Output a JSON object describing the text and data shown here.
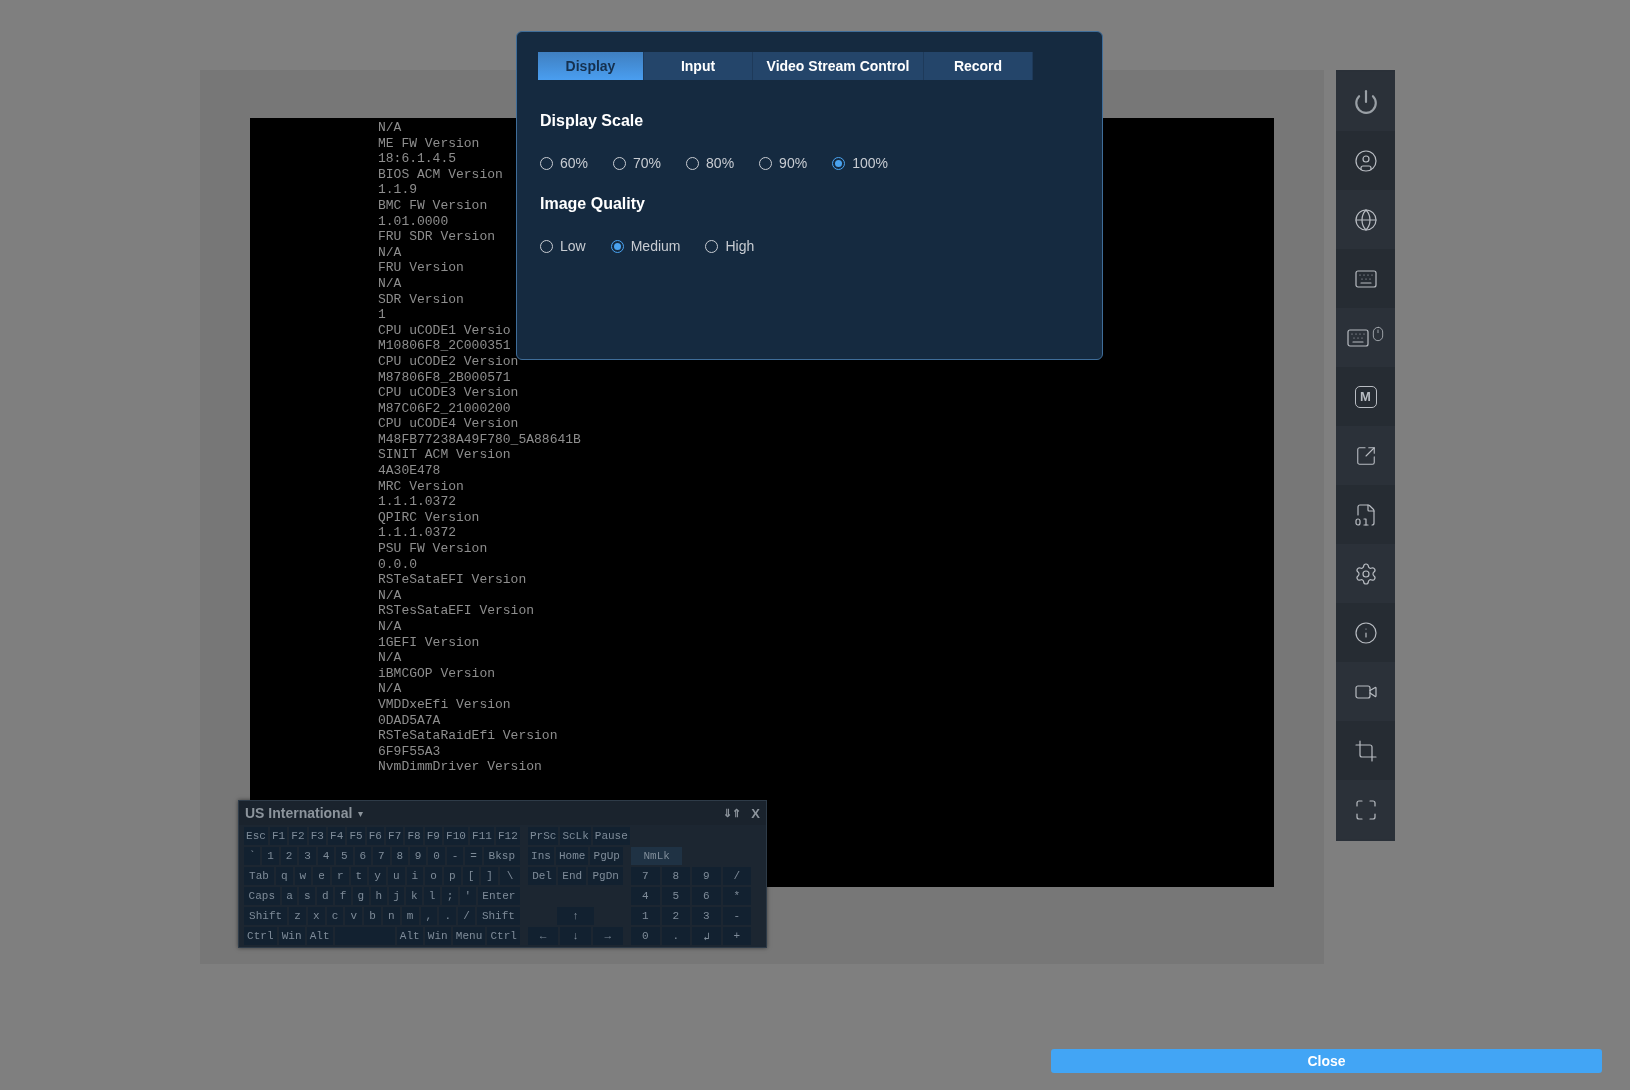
{
  "console": {
    "lines": [
      "N/A",
      "ME FW Version",
      "18:6.1.4.5",
      "BIOS ACM Version",
      "1.1.9",
      "BMC FW Version",
      "1.01.0000",
      "FRU SDR Version",
      "N/A",
      "FRU Version",
      "N/A",
      "SDR Version",
      "1",
      "CPU uCODE1 Versio",
      "M10806F8_2C000351",
      "CPU uCODE2 Version",
      "M87806F8_2B000571",
      "CPU uCODE3 Version",
      "M87C06F2_21000200",
      "CPU uCODE4 Version",
      "M48FB77238A49F780_5A88641B",
      "SINIT ACM Version",
      "4A30E478",
      "MRC Version",
      "1.1.1.0372",
      "QPIRC Version",
      "1.1.1.0372",
      "PSU FW Version",
      "0.0.0",
      "RSTeSataEFI Version",
      "N/A",
      "RSTesSataEFI Version",
      "N/A",
      "1GEFI Version",
      "N/A",
      "iBMCGOP Version",
      "N/A",
      "VMDDxeEfi Version",
      "0DAD5A7A",
      "RSTeSataRaidEfi Version",
      "6F9F55A3",
      "NvmDimmDriver Version"
    ]
  },
  "sidebar": {
    "macro_label": "M"
  },
  "dialog": {
    "tabs": [
      {
        "label": "Display",
        "selected": true
      },
      {
        "label": "Input",
        "selected": false
      },
      {
        "label": "Video Stream Control",
        "selected": false
      },
      {
        "label": "Record",
        "selected": false
      }
    ],
    "sections": [
      {
        "title": "Display Scale",
        "options": [
          {
            "label": "60%",
            "selected": false
          },
          {
            "label": "70%",
            "selected": false
          },
          {
            "label": "80%",
            "selected": false
          },
          {
            "label": "90%",
            "selected": false
          },
          {
            "label": "100%",
            "selected": true
          }
        ]
      },
      {
        "title": "Image Quality",
        "options": [
          {
            "label": "Low",
            "selected": false
          },
          {
            "label": "Medium",
            "selected": true
          },
          {
            "label": "High",
            "selected": false
          }
        ]
      }
    ]
  },
  "keyboard": {
    "layout": "US International",
    "layout_caret": "▾",
    "dock_arrows": "⇓⇑",
    "close": "X",
    "main": [
      [
        {
          "label": "Esc",
          "kind": "wide"
        },
        {
          "label": "F1",
          "kind": "key"
        },
        {
          "label": "F2",
          "kind": "key"
        },
        {
          "label": "F3",
          "kind": "key"
        },
        {
          "label": "F4",
          "kind": "key"
        },
        {
          "label": "F5",
          "kind": "key"
        },
        {
          "label": "F6",
          "kind": "key"
        },
        {
          "label": "F7",
          "kind": "key"
        },
        {
          "label": "F8",
          "kind": "key"
        },
        {
          "label": "F9",
          "kind": "key"
        },
        {
          "label": "F10",
          "kind": "key"
        },
        {
          "label": "F11",
          "kind": "key"
        },
        {
          "label": "F12",
          "kind": "wide"
        }
      ],
      [
        {
          "label": "`",
          "kind": "key"
        },
        {
          "label": "1",
          "kind": "key"
        },
        {
          "label": "2",
          "kind": "key"
        },
        {
          "label": "3",
          "kind": "key"
        },
        {
          "label": "4",
          "kind": "key"
        },
        {
          "label": "5",
          "kind": "key"
        },
        {
          "label": "6",
          "kind": "key"
        },
        {
          "label": "7",
          "kind": "key"
        },
        {
          "label": "8",
          "kind": "key"
        },
        {
          "label": "9",
          "kind": "key"
        },
        {
          "label": "0",
          "kind": "key"
        },
        {
          "label": "-",
          "kind": "key"
        },
        {
          "label": "=",
          "kind": "key"
        },
        {
          "label": "Bksp",
          "kind": "wide"
        }
      ],
      [
        {
          "label": "Tab",
          "kind": "wide"
        },
        {
          "label": "q",
          "kind": "key"
        },
        {
          "label": "w",
          "kind": "key"
        },
        {
          "label": "e",
          "kind": "key"
        },
        {
          "label": "r",
          "kind": "key"
        },
        {
          "label": "t",
          "kind": "key"
        },
        {
          "label": "y",
          "kind": "key"
        },
        {
          "label": "u",
          "kind": "key"
        },
        {
          "label": "i",
          "kind": "key"
        },
        {
          "label": "o",
          "kind": "key"
        },
        {
          "label": "p",
          "kind": "key"
        },
        {
          "label": "[",
          "kind": "key"
        },
        {
          "label": "]",
          "kind": "key"
        },
        {
          "label": "\\",
          "kind": "wide"
        }
      ],
      [
        {
          "label": "Caps",
          "kind": "wide"
        },
        {
          "label": "a",
          "kind": "key"
        },
        {
          "label": "s",
          "kind": "key"
        },
        {
          "label": "d",
          "kind": "key"
        },
        {
          "label": "f",
          "kind": "key"
        },
        {
          "label": "g",
          "kind": "key"
        },
        {
          "label": "h",
          "kind": "key"
        },
        {
          "label": "j",
          "kind": "key"
        },
        {
          "label": "k",
          "kind": "key"
        },
        {
          "label": "l",
          "kind": "key"
        },
        {
          "label": ";",
          "kind": "key"
        },
        {
          "label": "'",
          "kind": "key"
        },
        {
          "label": "Enter",
          "kind": "wide"
        }
      ],
      [
        {
          "label": "Shift",
          "kind": "wide"
        },
        {
          "label": "z",
          "kind": "key"
        },
        {
          "label": "x",
          "kind": "key"
        },
        {
          "label": "c",
          "kind": "key"
        },
        {
          "label": "v",
          "kind": "key"
        },
        {
          "label": "b",
          "kind": "key"
        },
        {
          "label": "n",
          "kind": "key"
        },
        {
          "label": "m",
          "kind": "key"
        },
        {
          "label": ",",
          "kind": "key"
        },
        {
          "label": ".",
          "kind": "key"
        },
        {
          "label": "/",
          "kind": "key"
        },
        {
          "label": "Shift",
          "kind": "wide"
        }
      ],
      [
        {
          "label": "Ctrl",
          "kind": "key"
        },
        {
          "label": "Win",
          "kind": "key"
        },
        {
          "label": "Alt",
          "kind": "key"
        },
        {
          "kind": "space"
        },
        {
          "label": "Alt",
          "kind": "key"
        },
        {
          "label": "Win",
          "kind": "key"
        },
        {
          "label": "Menu",
          "kind": "key"
        },
        {
          "label": "Ctrl",
          "kind": "key"
        }
      ]
    ],
    "nav": [
      [
        {
          "label": "PrSc",
          "kind": "key"
        },
        {
          "label": "ScLk",
          "kind": "key"
        },
        {
          "label": "Pause",
          "kind": "key"
        }
      ],
      [
        {
          "label": "Ins",
          "kind": "key"
        },
        {
          "label": "Home",
          "kind": "key"
        },
        {
          "label": "PgUp",
          "kind": "key"
        }
      ],
      [
        {
          "label": "Del",
          "kind": "key"
        },
        {
          "label": "End",
          "kind": "key"
        },
        {
          "label": "PgDn",
          "kind": "key"
        }
      ],
      [
        {
          "kind": "gap"
        },
        {
          "kind": "gap"
        },
        {
          "kind": "gap"
        }
      ],
      [
        {
          "kind": "gap"
        },
        {
          "label": "↑",
          "kind": "key"
        },
        {
          "kind": "gap"
        }
      ],
      [
        {
          "label": "←",
          "kind": "key"
        },
        {
          "label": "↓",
          "kind": "key"
        },
        {
          "label": "→",
          "kind": "key"
        }
      ]
    ],
    "numpad": [
      [
        {
          "label": "NmLk",
          "kind": "key",
          "on": true
        },
        {
          "kind": "gap"
        },
        {
          "kind": "gap"
        },
        {
          "kind": "gap"
        }
      ],
      [
        {
          "label": "7",
          "kind": "key",
          "on": false
        },
        {
          "label": "8",
          "kind": "key",
          "on": false
        },
        {
          "label": "9",
          "kind": "key",
          "on": false
        },
        {
          "label": "/",
          "kind": "key",
          "on": false
        }
      ],
      [
        {
          "label": "4",
          "kind": "key",
          "on": false
        },
        {
          "label": "5",
          "kind": "key",
          "on": false
        },
        {
          "label": "6",
          "kind": "key",
          "on": false
        },
        {
          "label": "*",
          "kind": "key",
          "on": false
        }
      ],
      [
        {
          "label": "1",
          "kind": "key",
          "on": false
        },
        {
          "label": "2",
          "kind": "key",
          "on": false
        },
        {
          "label": "3",
          "kind": "key",
          "on": false
        },
        {
          "label": "-",
          "kind": "key",
          "on": false
        }
      ],
      [
        {
          "label": "0",
          "kind": "key",
          "on": false
        },
        {
          "label": ".",
          "kind": "key",
          "on": false
        },
        {
          "label": "↲",
          "kind": "key",
          "on": false
        },
        {
          "label": "+",
          "kind": "key",
          "on": false
        }
      ]
    ]
  },
  "close_button": "Close"
}
